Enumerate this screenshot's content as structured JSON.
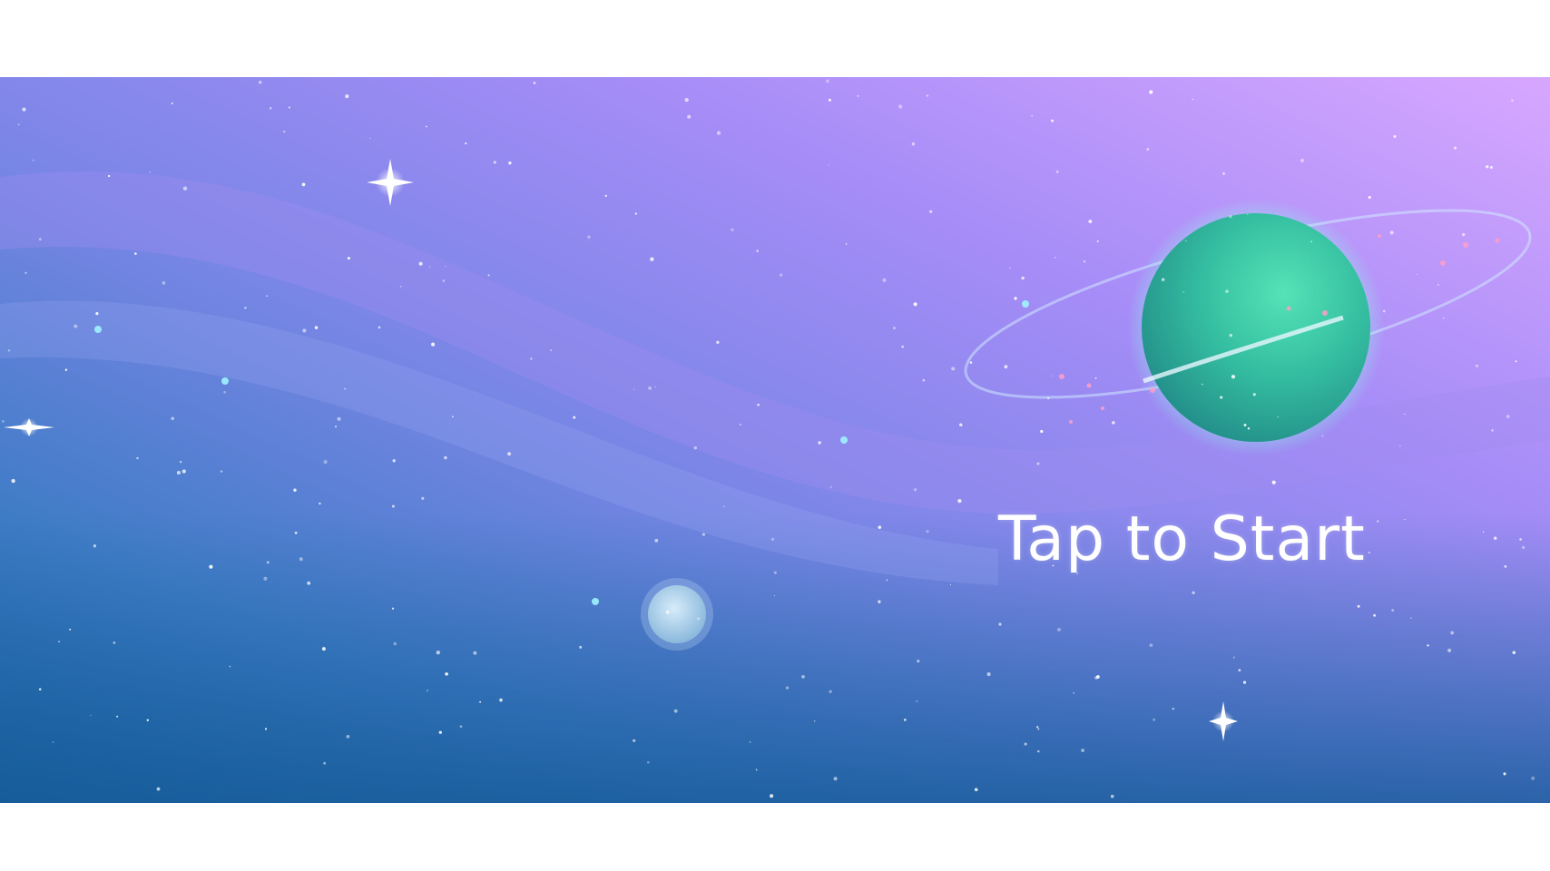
{
  "screen": {
    "prompt_text": "Tap to Start",
    "letterbox_color": "#ffffff"
  },
  "scene": {
    "sky_colors": {
      "top_right": "#d7a7ff",
      "top_left": "#8a8ff0",
      "middle": "#7d86e6",
      "bottom": "#1d6aa8"
    },
    "nebula_color": "#a18cf0",
    "ringed_planet_color": "#3fc9a6",
    "ring_color": "#cfe8ff",
    "ring_specks_color": "#ff9ec7",
    "moon_color": "#a9cde9",
    "star_color": "#ffffff"
  }
}
